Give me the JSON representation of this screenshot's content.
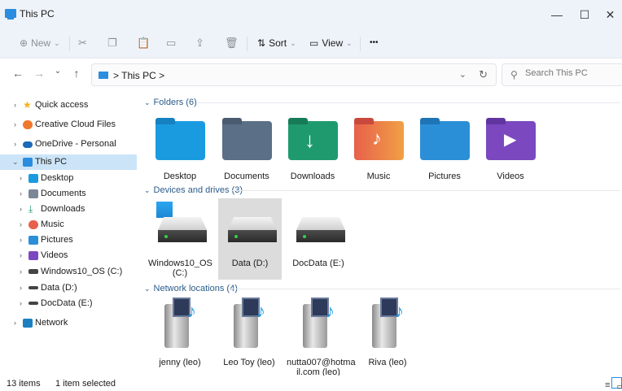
{
  "window": {
    "title": "This PC",
    "minimize": "—",
    "maximize": "☐",
    "close": "✕"
  },
  "toolbar": {
    "new_label": "New",
    "sort_label": "Sort",
    "view_label": "View",
    "more_label": "•••"
  },
  "nav": {
    "back": "←",
    "forward": "→",
    "recent": "⌄",
    "up": "↑"
  },
  "address": {
    "breadcrumb": "> This PC >",
    "dropdown": "⌄",
    "refresh": "↻"
  },
  "search": {
    "placeholder": "Search This PC"
  },
  "sidebar": {
    "items": [
      {
        "label": "Quick access"
      },
      {
        "label": "Creative Cloud Files"
      },
      {
        "label": "OneDrive - Personal"
      },
      {
        "label": "This PC"
      },
      {
        "label": "Desktop"
      },
      {
        "label": "Documents"
      },
      {
        "label": "Downloads"
      },
      {
        "label": "Music"
      },
      {
        "label": "Pictures"
      },
      {
        "label": "Videos"
      },
      {
        "label": "Windows10_OS (C:)"
      },
      {
        "label": "Data (D:)"
      },
      {
        "label": "DocData (E:)"
      },
      {
        "label": "Network"
      }
    ]
  },
  "groups": {
    "folders": {
      "header": "Folders (6)"
    },
    "drives": {
      "header": "Devices and drives (3)"
    },
    "network": {
      "header": "Network locations (4)"
    }
  },
  "folders": [
    {
      "label": "Desktop",
      "color": "#1a9be0"
    },
    {
      "label": "Documents",
      "color": "#5b6f86"
    },
    {
      "label": "Downloads",
      "color": "#1f9a6e"
    },
    {
      "label": "Music",
      "color": "#e8604c"
    },
    {
      "label": "Pictures",
      "color": "#2b8fd8"
    },
    {
      "label": "Videos",
      "color": "#7b48c0"
    }
  ],
  "drives": [
    {
      "label_line1": "Windows10_OS",
      "label_line2": "(C:)"
    },
    {
      "label_line1": "Data (D:)",
      "label_line2": ""
    },
    {
      "label_line1": "DocData (E:)",
      "label_line2": ""
    }
  ],
  "network": [
    {
      "label_line1": "jenny (leo)",
      "label_line2": ""
    },
    {
      "label_line1": "Leo Toy (leo)",
      "label_line2": ""
    },
    {
      "label_line1": "nutta007@hotma",
      "label_line2": "il.com (leo)"
    },
    {
      "label_line1": "Riva (leo)",
      "label_line2": ""
    }
  ],
  "status": {
    "items": "13 items",
    "selected": "1 item selected"
  }
}
